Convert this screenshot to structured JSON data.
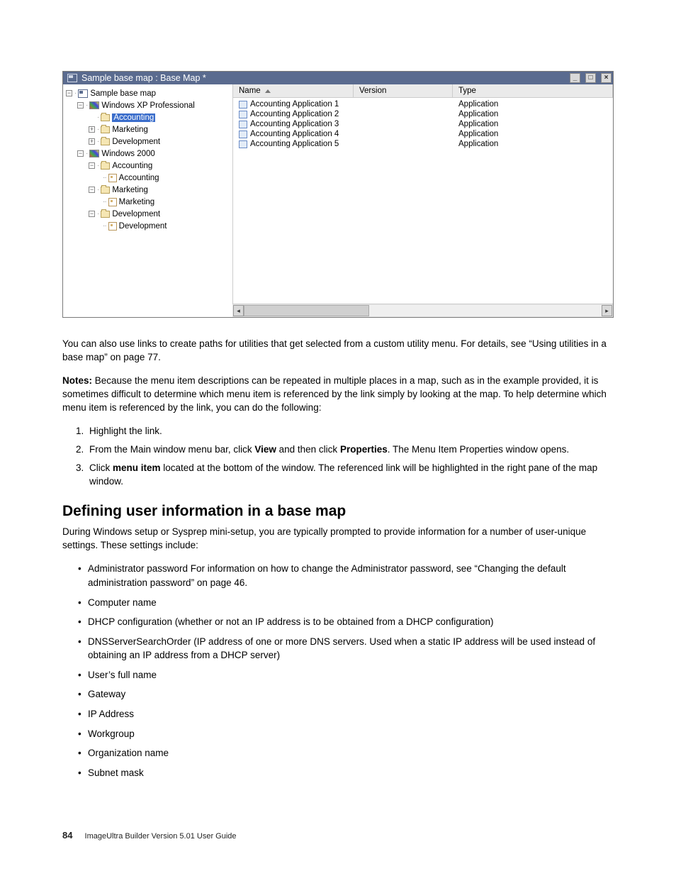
{
  "window": {
    "title": "Sample base map : Base Map *",
    "tree": {
      "root": "Sample base map",
      "xp": "Windows XP Professional",
      "xp_accounting": "Accounting",
      "xp_marketing": "Marketing",
      "xp_development": "Development",
      "w2k": "Windows 2000",
      "w2k_accounting": "Accounting",
      "w2k_accounting_link": "Accounting",
      "w2k_marketing": "Marketing",
      "w2k_marketing_link": "Marketing",
      "w2k_development": "Development",
      "w2k_development_link": "Development"
    },
    "columns": {
      "name": "Name",
      "version": "Version",
      "type": "Type"
    },
    "rows": [
      {
        "name": "Accounting Application 1",
        "version": "",
        "type": "Application"
      },
      {
        "name": "Accounting Application 2",
        "version": "",
        "type": "Application"
      },
      {
        "name": "Accounting Application 3",
        "version": "",
        "type": "Application"
      },
      {
        "name": "Accounting Application 4",
        "version": "",
        "type": "Application"
      },
      {
        "name": "Accounting Application 5",
        "version": "",
        "type": "Application"
      }
    ]
  },
  "text": {
    "para1": "You can also use links to create paths for utilities that get selected from a custom utility menu. For details, see “Using utilities in a base map” on page 77.",
    "notes_label": "Notes:",
    "notes_body": " Because the menu item descriptions can be repeated in multiple places in a map, such as in the example provided, it is sometimes difficult to determine which menu item is referenced by the link simply by looking at the map. To help determine which menu item is referenced by the link, you can do the following:",
    "ol1": "Highlight the link.",
    "ol2a": "From the Main window menu bar, click ",
    "ol2b_view": "View",
    "ol2c": " and then click ",
    "ol2d_properties": "Properties",
    "ol2e": ". The Menu Item Properties window opens.",
    "ol3a": "Click ",
    "ol3b_menuitem": "menu item",
    "ol3c": " located at the bottom of the window. The referenced link will be highlighted in the right pane of the map window.",
    "heading": "Defining user information in a base map",
    "para2": "During Windows setup or Sysprep mini-setup, you are typically prompted to provide information for a number of user-unique settings. These settings include:",
    "ul1": "Administrator password For information on how to change the Administrator password, see “Changing the default administration password” on page 46.",
    "ul2": "Computer name",
    "ul3": "DHCP configuration (whether or not an IP address is to be obtained from a DHCP configuration)",
    "ul4": "DNSServerSearchOrder (IP address of one or more DNS servers. Used when a static IP address will be used instead of obtaining an IP address from a DHCP server)",
    "ul5": "User’s full name",
    "ul6": "Gateway",
    "ul7": "IP Address",
    "ul8": "Workgroup",
    "ul9": "Organization name",
    "ul10": "Subnet mask"
  },
  "footer": {
    "page": "84",
    "doc": "ImageUltra Builder Version 5.01 User Guide"
  }
}
